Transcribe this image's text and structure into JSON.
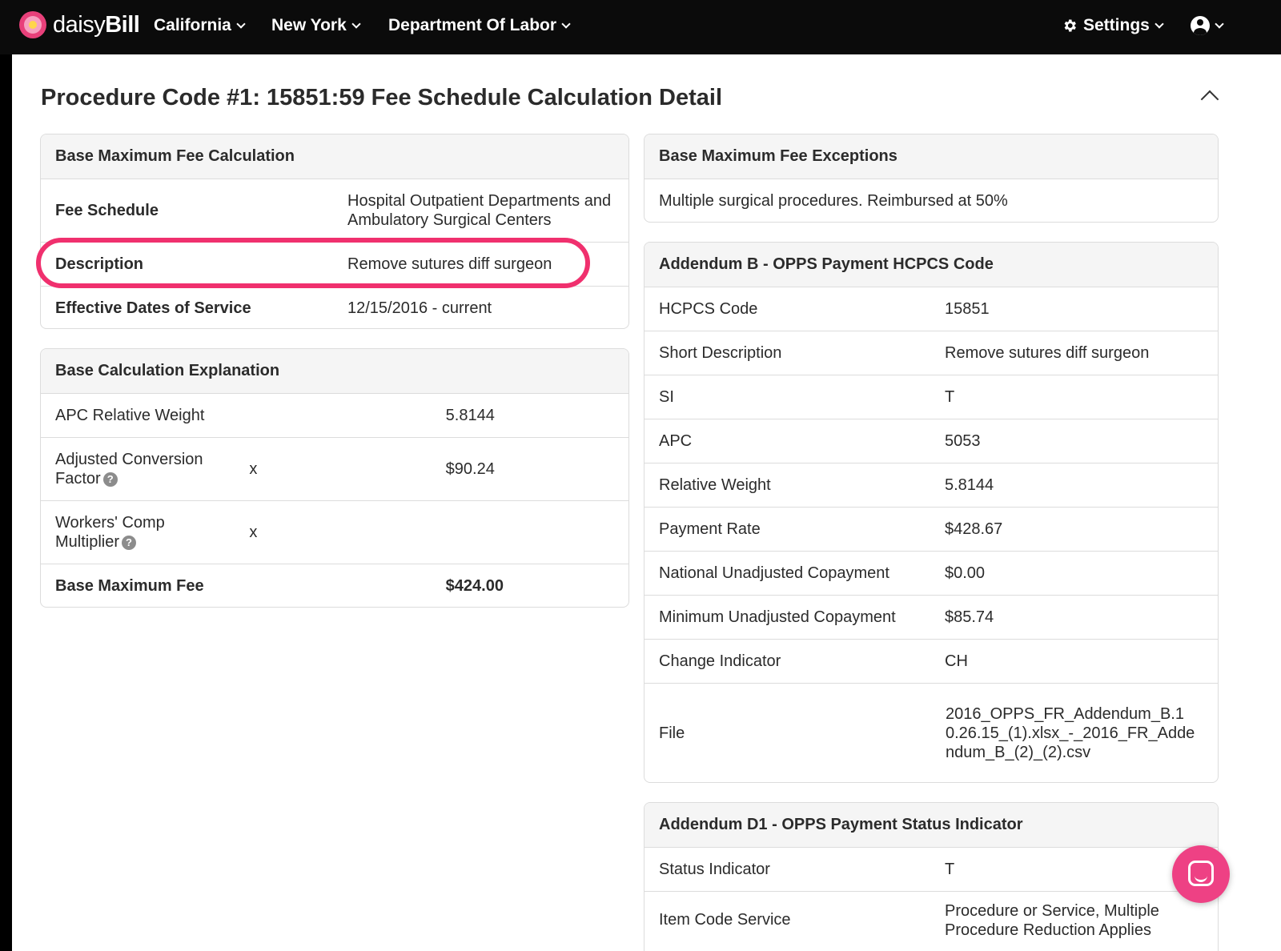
{
  "nav": {
    "logo_prefix": "daisy",
    "logo_suffix": "Bill",
    "items": [
      "California",
      "New York",
      "Department Of Labor"
    ],
    "settings_label": "Settings"
  },
  "title": {
    "strong": "Procedure Code #1: 15851:59",
    "rest": "Fee Schedule Calculation Detail"
  },
  "base_fee": {
    "header": "Base Maximum Fee Calculation",
    "rows": [
      {
        "label": "Fee Schedule",
        "value": "Hospital Outpatient Departments and Ambulatory Surgical Centers"
      },
      {
        "label": "Description",
        "value": "Remove sutures diff surgeon"
      },
      {
        "label": "Effective Dates of Service",
        "value": "12/15/2016 - current"
      }
    ]
  },
  "explanation": {
    "header": "Base Calculation Explanation",
    "rows": [
      {
        "label": "APC Relative Weight",
        "op": "",
        "value": "5.8144"
      },
      {
        "label": "Adjusted Conversion Factor",
        "op": "x",
        "value": "$90.24"
      },
      {
        "label": "Workers' Comp Multiplier",
        "op": "x",
        "value": ""
      },
      {
        "label": "Base Maximum Fee",
        "op": "",
        "value": "$424.00"
      }
    ]
  },
  "exceptions": {
    "header": "Base Maximum Fee Exceptions",
    "text": "Multiple surgical procedures. Reimbursed at 50%"
  },
  "addendum_b": {
    "header": "Addendum B - OPPS Payment HCPCS Code",
    "rows": [
      {
        "label": "HCPCS Code",
        "value": "15851"
      },
      {
        "label": "Short Description",
        "value": "Remove sutures diff surgeon"
      },
      {
        "label": "SI",
        "value": "T"
      },
      {
        "label": "APC",
        "value": "5053"
      },
      {
        "label": "Relative Weight",
        "value": "5.8144"
      },
      {
        "label": "Payment Rate",
        "value": "$428.67"
      },
      {
        "label": "National Unadjusted Copayment",
        "value": "$0.00"
      },
      {
        "label": "Minimum Unadjusted Copayment",
        "value": "$85.74"
      },
      {
        "label": "Change Indicator",
        "value": "CH"
      },
      {
        "label": "File",
        "value": "2016_OPPS_FR_Addendum_B.10.26.15_(1).xlsx_-_2016_FR_Addendum_B_(2)_(2).csv"
      }
    ]
  },
  "addendum_d1": {
    "header": "Addendum D1 - OPPS Payment Status Indicator",
    "rows": [
      {
        "label": "Status Indicator",
        "value": "T"
      },
      {
        "label": "Item Code Service",
        "value": "Procedure or Service, Multiple Procedure Reduction Applies"
      }
    ]
  },
  "colors": {
    "accent": "#f0306e",
    "nav_bg": "#0b0b0b",
    "chat": "#ee4184"
  }
}
